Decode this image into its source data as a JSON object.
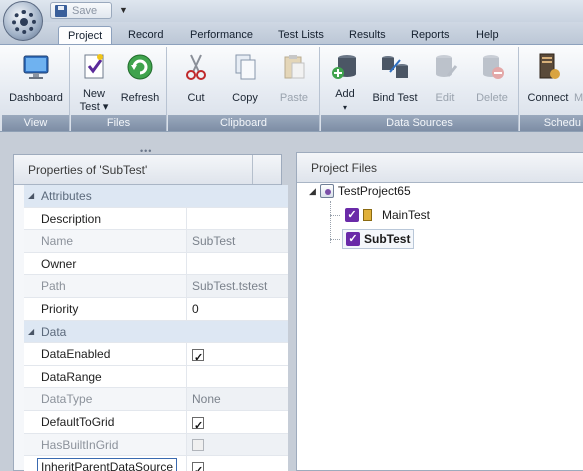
{
  "titlebar": {
    "save_label": "Save"
  },
  "tabs": [
    "Project",
    "Record",
    "Performance",
    "Test Lists",
    "Results",
    "Reports",
    "Help"
  ],
  "ribbon": {
    "groups": {
      "view": "View",
      "files": "Files",
      "clipboard": "Clipboard",
      "datasources": "Data Sources",
      "schedule": "Schedu"
    },
    "buttons": {
      "dashboard": "Dashboard",
      "newtest_line1": "New",
      "newtest_line2": "Test ▾",
      "refresh": "Refresh",
      "cut": "Cut",
      "copy": "Copy",
      "paste": "Paste",
      "add": "Add",
      "add_arrow": "▾",
      "bindtest": "Bind Test",
      "edit": "Edit",
      "delete": "Delete",
      "connect": "Connect",
      "cut_off": "M"
    }
  },
  "properties": {
    "title": "Properties of 'SubTest'",
    "categories": {
      "attributes": "Attributes",
      "data": "Data"
    },
    "rows": {
      "description": {
        "name": "Description",
        "value": ""
      },
      "name": {
        "name": "Name",
        "value": "SubTest"
      },
      "owner": {
        "name": "Owner",
        "value": ""
      },
      "path": {
        "name": "Path",
        "value": "SubTest.tstest"
      },
      "priority": {
        "name": "Priority",
        "value": "0"
      },
      "dataenabled": {
        "name": "DataEnabled",
        "checked": true
      },
      "datarange": {
        "name": "DataRange",
        "value": ""
      },
      "datatype": {
        "name": "DataType",
        "value": "None"
      },
      "defaulttogrid": {
        "name": "DefaultToGrid",
        "checked": true
      },
      "hasbuiltingrid": {
        "name": "HasBuiltInGrid",
        "checked": false
      },
      "inheritparent": {
        "name": "InheritParentDataSource",
        "checked": true
      }
    }
  },
  "files": {
    "title": "Project Files",
    "project": "TestProject65",
    "items": [
      "MainTest",
      "SubTest"
    ]
  }
}
